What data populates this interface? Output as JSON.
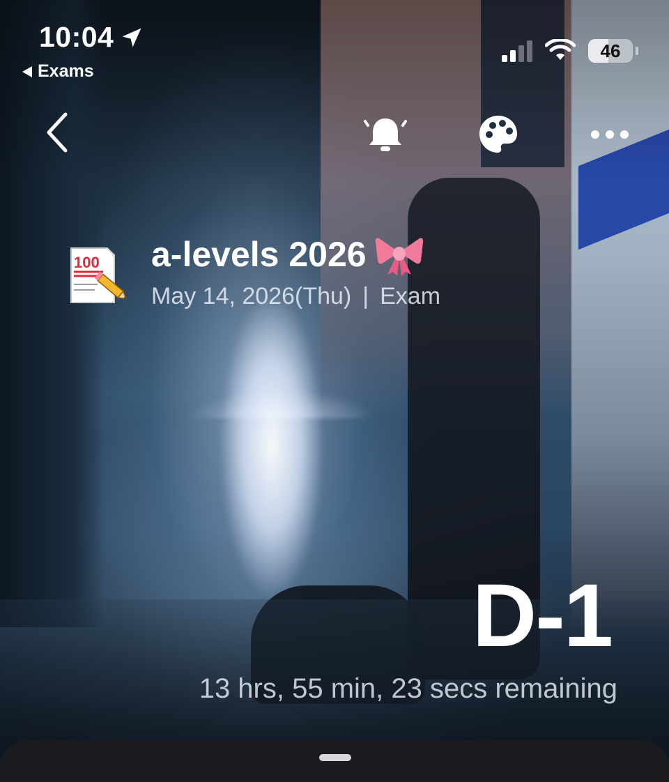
{
  "status_bar": {
    "time": "10:04",
    "back_app_label": "Exams",
    "battery_percent": "46",
    "battery_level": 0.46,
    "signal_bars_active": 2,
    "signal_bars_total": 4
  },
  "nav": {
    "back_icon": "chevron-left-icon",
    "actions": [
      "bell-icon",
      "palette-icon",
      "more-icon"
    ]
  },
  "event": {
    "emoji": "💯📝",
    "title": "a-levels 2026",
    "title_emoji": "🎀",
    "date": "May 14, 2026(Thu)",
    "separator": "|",
    "category": "Exam"
  },
  "countdown": {
    "dday": "D-1",
    "remaining": "13 hrs, 55 min, 23 secs remaining"
  },
  "colors": {
    "text_primary": "#ffffff",
    "text_secondary": "#e6ecf4",
    "sheet_bg": "#1b1c20",
    "bow_pink": "#f07a9a"
  }
}
